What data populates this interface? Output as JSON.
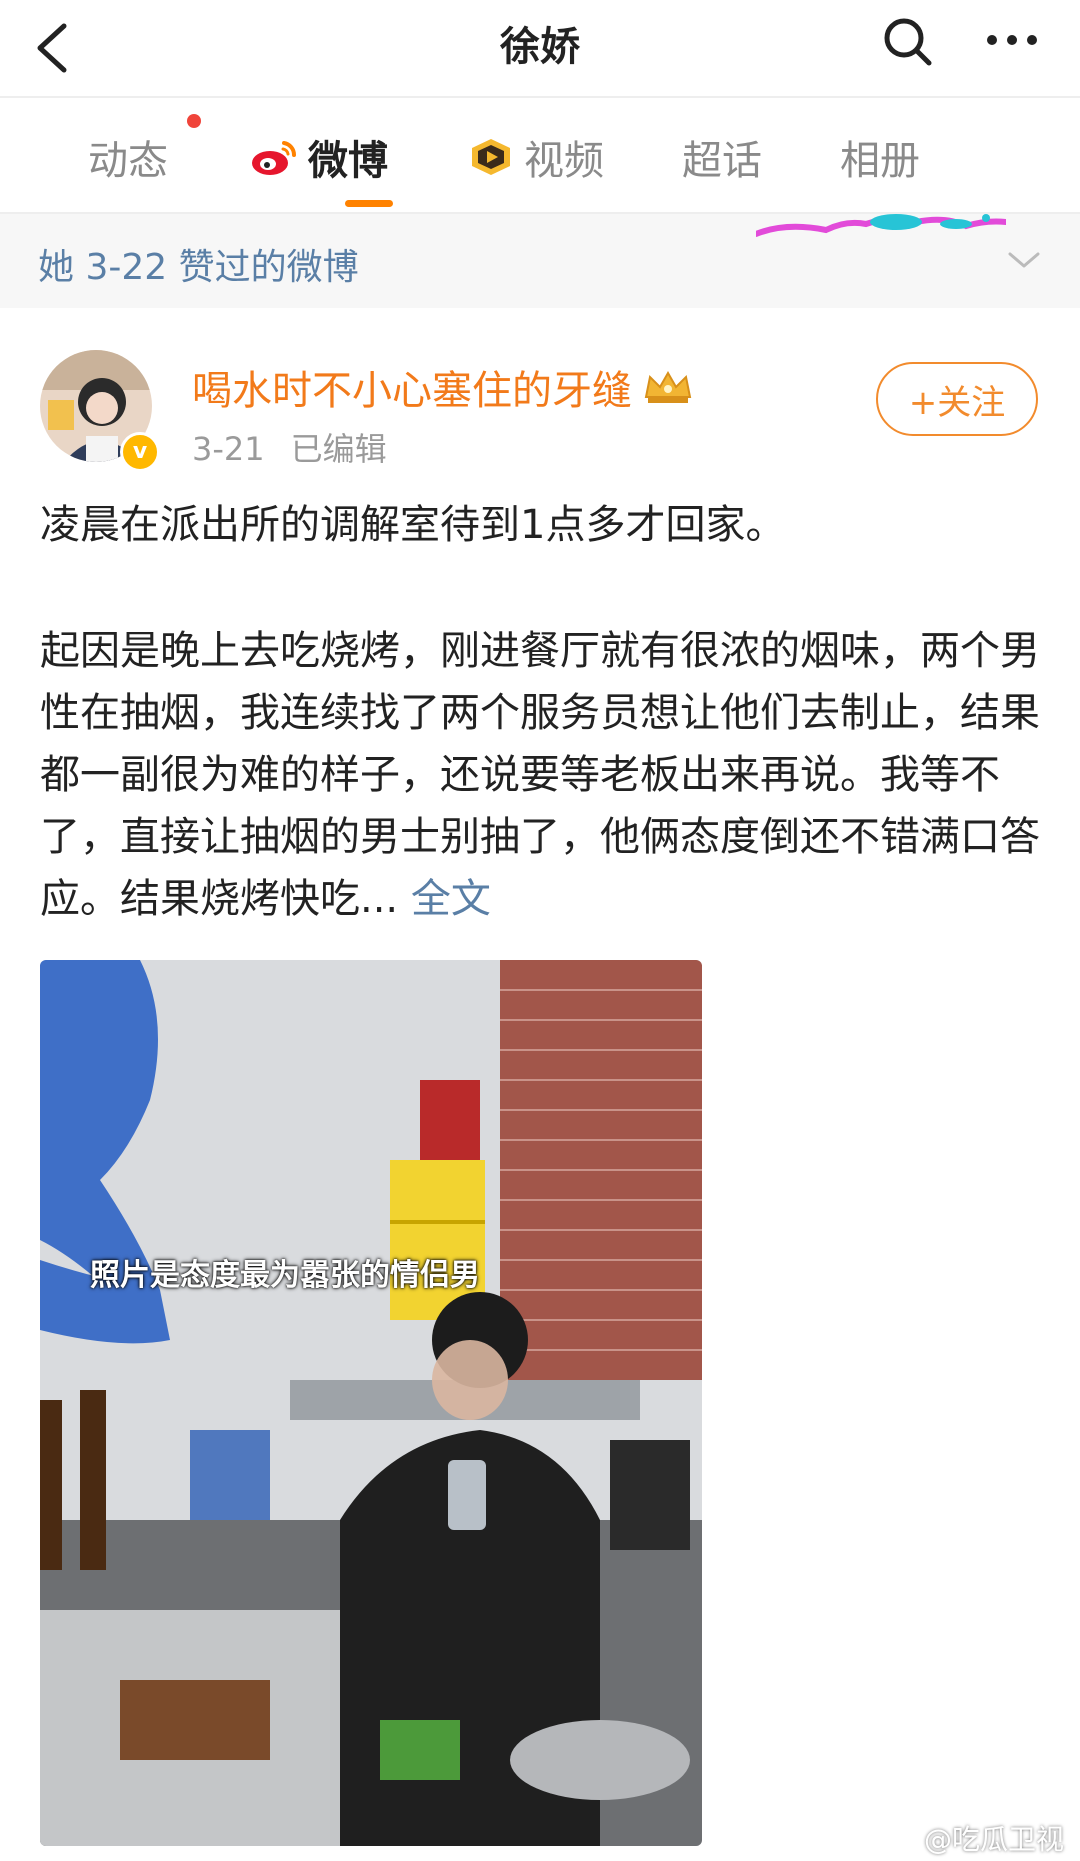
{
  "header": {
    "title": "徐娇"
  },
  "tabs": [
    {
      "label": "动态"
    },
    {
      "label": "微博"
    },
    {
      "label": "视频"
    },
    {
      "label": "超话"
    },
    {
      "label": "相册"
    }
  ],
  "liked_bar": {
    "text": "她 3-22 赞过的微博"
  },
  "post": {
    "username": "喝水时不小心塞住的牙缝",
    "date": "3-21",
    "edited": "已编辑",
    "follow_label": "+关注",
    "paragraph1": "凌晨在派出所的调解室待到1点多才回家。",
    "paragraph2": "起因是晚上去吃烧烤，刚进餐厅就有很浓的烟味，两个男性在抽烟，我连续找了两个服务员想让他们去制止，结果都一副很为难的样子，还说要等老板出来再说。我等不了，直接让抽烟的男士别抽了，他俩态度倒还不错满口答应。结果烧烤快吃...",
    "full_text_link": "全文",
    "photo_caption": "照片是态度最为嚣张的情侣男"
  },
  "watermark": "@吃瓜卫视",
  "colors": {
    "accent_orange": "#ff8200",
    "username_orange": "#f27a1a",
    "link_blue": "#5a7fa6",
    "notification_red": "#f0443a"
  }
}
